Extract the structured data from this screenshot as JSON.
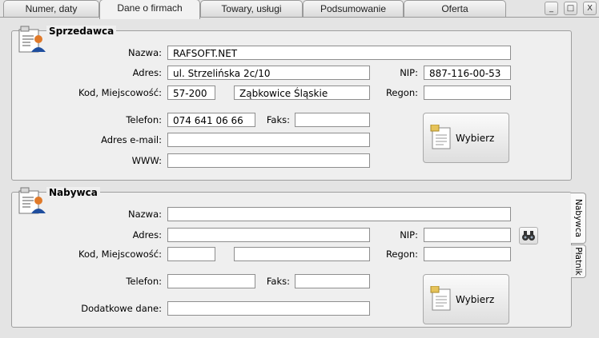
{
  "tabs": [
    "Numer, daty",
    "Dane o firmach",
    "Towary, usługi",
    "Podsumowanie",
    "Oferta"
  ],
  "active_tab": "Dane o firmach",
  "window_controls": {
    "minimize": "_",
    "restore": "□",
    "close": "X"
  },
  "seller": {
    "title": "Sprzedawca",
    "labels": {
      "name": "Nazwa:",
      "address": "Adres:",
      "nip": "NIP:",
      "postal_city": "Kod, Miejscowość:",
      "regon": "Regon:",
      "phone": "Telefon:",
      "fax": "Faks:",
      "email": "Adres e-mail:",
      "www": "WWW:"
    },
    "values": {
      "name": "RAFSOFT.NET",
      "address": "ul. Strzelińska 2c/10",
      "nip": "887-116-00-53",
      "postal_code": "57-200",
      "city": "Ząbkowice Śląskie",
      "regon": "",
      "phone": "074 641 06 66",
      "fax": "",
      "email": "",
      "www": ""
    },
    "select_button": "Wybierz"
  },
  "buyer": {
    "title": "Nabywca",
    "labels": {
      "name": "Nazwa:",
      "address": "Adres:",
      "nip": "NIP:",
      "postal_city": "Kod, Miejscowość:",
      "regon": "Regon:",
      "phone": "Telefon:",
      "fax": "Faks:",
      "extra": "Dodatkowe dane:"
    },
    "values": {
      "name": "",
      "address": "",
      "nip": "",
      "postal_code": "",
      "city": "",
      "regon": "",
      "phone": "",
      "fax": "",
      "extra": ""
    },
    "select_button": "Wybierz"
  },
  "side_tabs": [
    "Nabywca",
    "Płatnik"
  ]
}
